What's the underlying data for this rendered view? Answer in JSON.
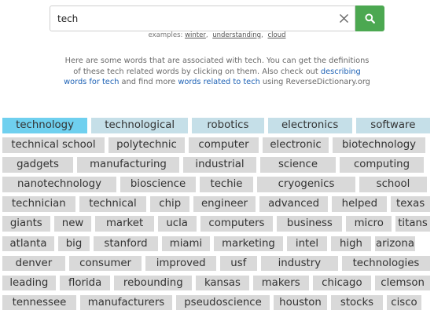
{
  "search": {
    "query": "tech",
    "clear_icon": "close-icon",
    "submit_icon": "search-icon",
    "accent_color": "#4ca851"
  },
  "examples": {
    "prefix": "examples: ",
    "items": [
      "winter",
      "understanding",
      "cloud"
    ]
  },
  "intro": {
    "text1": "Here are some words that are associated with tech. You can get the definitions of these tech related words by clicking on them. Also check out ",
    "link1": "describing words for tech",
    "text2": " and find more ",
    "link2": "words related to tech",
    "text3": " using ReverseDictionary.org"
  },
  "colors": {
    "highlight": "#6fd0ef",
    "top_tier": "#c5dfe8",
    "default": "#d9d9d9"
  },
  "words": [
    "technology",
    "technological",
    "robotics",
    "electronics",
    "software",
    "technical school",
    "polytechnic",
    "computer",
    "electronic",
    "biotechnology",
    "gadgets",
    "manufacturing",
    "industrial",
    "science",
    "computing",
    "nanotechnology",
    "bioscience",
    "techie",
    "cryogenics",
    "school",
    "technician",
    "technical",
    "chip",
    "engineer",
    "advanced",
    "helped",
    "texas",
    "giants",
    "new",
    "market",
    "ucla",
    "computers",
    "business",
    "micro",
    "titans",
    "atlanta",
    "big",
    "stanford",
    "miami",
    "marketing",
    "intel",
    "high",
    "arizona",
    "denver",
    "consumer",
    "improved",
    "usf",
    "industry",
    "technologies",
    "leading",
    "florida",
    "rebounding",
    "kansas",
    "makers",
    "chicago",
    "clemson",
    "tennessee",
    "manufacturers",
    "pseudoscience",
    "houston",
    "stocks",
    "cisco"
  ]
}
